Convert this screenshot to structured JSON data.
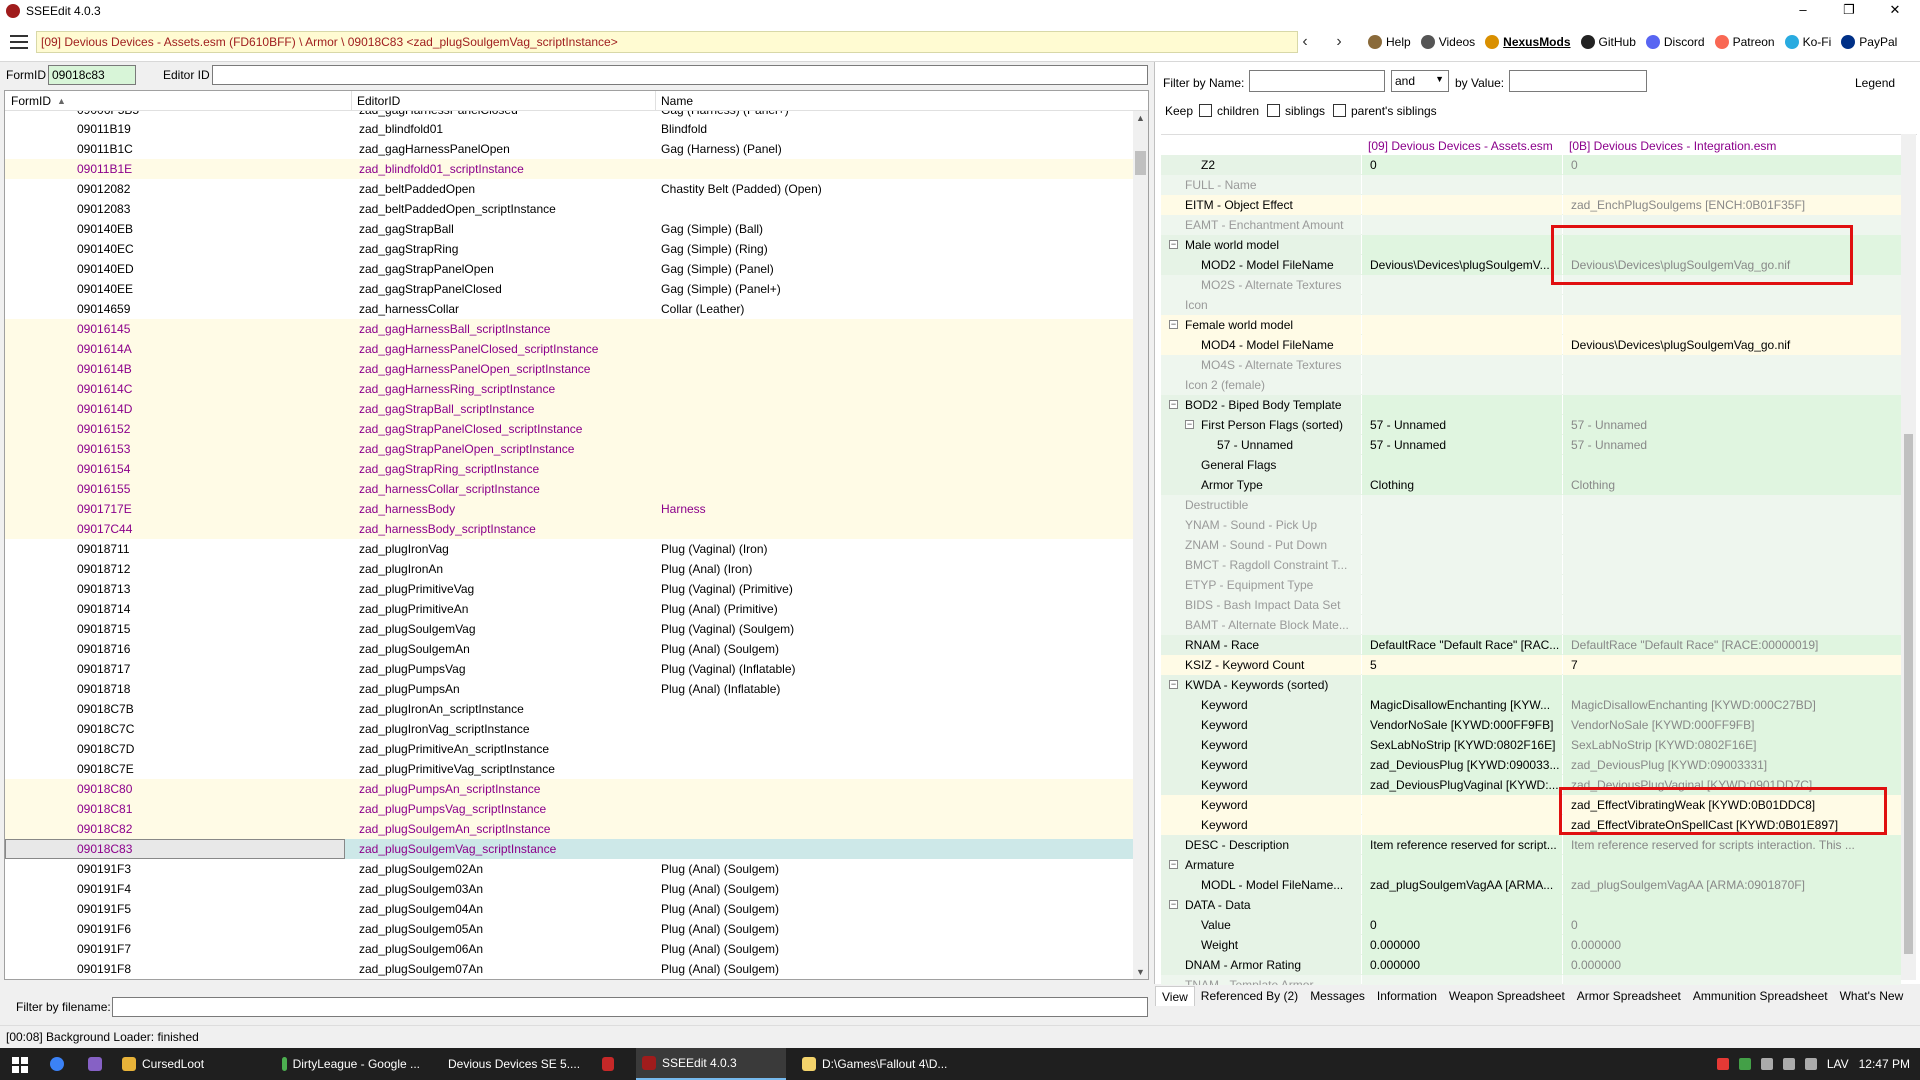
{
  "window": {
    "title": "SSEEdit 4.0.3",
    "minimize": "–",
    "maximize": "❐",
    "close": "✕"
  },
  "path": "[09] Devious Devices - Assets.esm (FD610BFF) \\ Armor \\ 09018C83 <zad_plugSoulgemVag_scriptInstance>",
  "nav": {
    "back": "‹",
    "forward": "›"
  },
  "links": [
    {
      "label": "Help",
      "color": "#8a6a3a",
      "bold": false
    },
    {
      "label": "Videos",
      "color": "#555555",
      "bold": false
    },
    {
      "label": "NexusMods",
      "color": "#d98f00",
      "bold": true
    },
    {
      "label": "GitHub",
      "color": "#222222",
      "bold": false
    },
    {
      "label": "Discord",
      "color": "#5865f2",
      "bold": false
    },
    {
      "label": "Patreon",
      "color": "#f96854",
      "bold": false
    },
    {
      "label": "Ko-Fi",
      "color": "#29abe0",
      "bold": false
    },
    {
      "label": "PayPal",
      "color": "#003087",
      "bold": false
    }
  ],
  "left": {
    "formid_label": "FormID",
    "formid_value": "09018c83",
    "editorid_label": "Editor ID",
    "headers": {
      "formid": "FormID",
      "sort": "▲",
      "editorid": "EditorID",
      "name": "Name"
    },
    "rows": [
      {
        "fid": "09011B19",
        "eid": "zad_blindfold01",
        "nm": "Blindfold",
        "y": false
      },
      {
        "fid": "09011B1C",
        "eid": "zad_gagHarnessPanelOpen",
        "nm": "Gag (Harness) (Panel)",
        "y": false
      },
      {
        "fid": "09011B1E",
        "eid": "zad_blindfold01_scriptInstance",
        "nm": "",
        "y": true
      },
      {
        "fid": "09012082",
        "eid": "zad_beltPaddedOpen",
        "nm": "Chastity Belt (Padded) (Open)",
        "y": false
      },
      {
        "fid": "09012083",
        "eid": "zad_beltPaddedOpen_scriptInstance",
        "nm": "",
        "y": false
      },
      {
        "fid": "090140EB",
        "eid": "zad_gagStrapBall",
        "nm": "Gag (Simple) (Ball)",
        "y": false
      },
      {
        "fid": "090140EC",
        "eid": "zad_gagStrapRing",
        "nm": "Gag (Simple) (Ring)",
        "y": false
      },
      {
        "fid": "090140ED",
        "eid": "zad_gagStrapPanelOpen",
        "nm": "Gag (Simple) (Panel)",
        "y": false
      },
      {
        "fid": "090140EE",
        "eid": "zad_gagStrapPanelClosed",
        "nm": "Gag (Simple) (Panel+)",
        "y": false
      },
      {
        "fid": "09014659",
        "eid": "zad_harnessCollar",
        "nm": "Collar (Leather)",
        "y": false
      },
      {
        "fid": "09016145",
        "eid": "zad_gagHarnessBall_scriptInstance",
        "nm": "",
        "y": true
      },
      {
        "fid": "0901614A",
        "eid": "zad_gagHarnessPanelClosed_scriptInstance",
        "nm": "",
        "y": true
      },
      {
        "fid": "0901614B",
        "eid": "zad_gagHarnessPanelOpen_scriptInstance",
        "nm": "",
        "y": true
      },
      {
        "fid": "0901614C",
        "eid": "zad_gagHarnessRing_scriptInstance",
        "nm": "",
        "y": true
      },
      {
        "fid": "0901614D",
        "eid": "zad_gagStrapBall_scriptInstance",
        "nm": "",
        "y": true
      },
      {
        "fid": "09016152",
        "eid": "zad_gagStrapPanelClosed_scriptInstance",
        "nm": "",
        "y": true
      },
      {
        "fid": "09016153",
        "eid": "zad_gagStrapPanelOpen_scriptInstance",
        "nm": "",
        "y": true
      },
      {
        "fid": "09016154",
        "eid": "zad_gagStrapRing_scriptInstance",
        "nm": "",
        "y": true
      },
      {
        "fid": "09016155",
        "eid": "zad_harnessCollar_scriptInstance",
        "nm": "",
        "y": true
      },
      {
        "fid": "0901717E",
        "eid": "zad_harnessBody",
        "nm": "Harness",
        "y": true
      },
      {
        "fid": "09017C44",
        "eid": "zad_harnessBody_scriptInstance",
        "nm": "",
        "y": true
      },
      {
        "fid": "09018711",
        "eid": "zad_plugIronVag",
        "nm": "Plug (Vaginal) (Iron)",
        "y": false
      },
      {
        "fid": "09018712",
        "eid": "zad_plugIronAn",
        "nm": "Plug (Anal) (Iron)",
        "y": false
      },
      {
        "fid": "09018713",
        "eid": "zad_plugPrimitiveVag",
        "nm": "Plug (Vaginal) (Primitive)",
        "y": false
      },
      {
        "fid": "09018714",
        "eid": "zad_plugPrimitiveAn",
        "nm": "Plug (Anal) (Primitive)",
        "y": false
      },
      {
        "fid": "09018715",
        "eid": "zad_plugSoulgemVag",
        "nm": "Plug (Vaginal) (Soulgem)",
        "y": false
      },
      {
        "fid": "09018716",
        "eid": "zad_plugSoulgemAn",
        "nm": "Plug (Anal) (Soulgem)",
        "y": false
      },
      {
        "fid": "09018717",
        "eid": "zad_plugPumpsVag",
        "nm": "Plug (Vaginal) (Inflatable)",
        "y": false
      },
      {
        "fid": "09018718",
        "eid": "zad_plugPumpsAn",
        "nm": "Plug (Anal) (Inflatable)",
        "y": false
      },
      {
        "fid": "09018C7B",
        "eid": "zad_plugIronAn_scriptInstance",
        "nm": "",
        "y": false
      },
      {
        "fid": "09018C7C",
        "eid": "zad_plugIronVag_scriptInstance",
        "nm": "",
        "y": false
      },
      {
        "fid": "09018C7D",
        "eid": "zad_plugPrimitiveAn_scriptInstance",
        "nm": "",
        "y": false
      },
      {
        "fid": "09018C7E",
        "eid": "zad_plugPrimitiveVag_scriptInstance",
        "nm": "",
        "y": false
      },
      {
        "fid": "09018C80",
        "eid": "zad_plugPumpsAn_scriptInstance",
        "nm": "",
        "y": true
      },
      {
        "fid": "09018C81",
        "eid": "zad_plugPumpsVag_scriptInstance",
        "nm": "",
        "y": true
      },
      {
        "fid": "09018C82",
        "eid": "zad_plugSoulgemAn_scriptInstance",
        "nm": "",
        "y": true
      },
      {
        "fid": "09018C83",
        "eid": "zad_plugSoulgemVag_scriptInstance",
        "nm": "",
        "y": true,
        "sel": true
      },
      {
        "fid": "090191F3",
        "eid": "zad_plugSoulgem02An",
        "nm": "Plug (Anal) (Soulgem)",
        "y": false
      },
      {
        "fid": "090191F4",
        "eid": "zad_plugSoulgem03An",
        "nm": "Plug (Anal) (Soulgem)",
        "y": false
      },
      {
        "fid": "090191F5",
        "eid": "zad_plugSoulgem04An",
        "nm": "Plug (Anal) (Soulgem)",
        "y": false
      },
      {
        "fid": "090191F6",
        "eid": "zad_plugSoulgem05An",
        "nm": "Plug (Anal) (Soulgem)",
        "y": false
      },
      {
        "fid": "090191F7",
        "eid": "zad_plugSoulgem06An",
        "nm": "Plug (Anal) (Soulgem)",
        "y": false
      },
      {
        "fid": "090191F8",
        "eid": "zad_plugSoulgem07An",
        "nm": "Plug (Anal) (Soulgem)",
        "y": false
      }
    ],
    "top_partial": {
      "fid": "09006F5B5",
      "eid": "zad_gagHarnessPanelClosed",
      "nm": "Gag (Harness) (Panel+)"
    },
    "filter_label": "Filter by filename:"
  },
  "right": {
    "filter_name_label": "Filter by Name:",
    "and_value": "and",
    "by_value_label": "by Value:",
    "legend": "Legend",
    "keep_label": "Keep",
    "children": "children",
    "siblings": "siblings",
    "parents_siblings": "parent's siblings",
    "col1": "[09] Devious Devices - Assets.esm",
    "col2": "[0B] Devious Devices - Integration.esm",
    "rows": [
      {
        "lab": "Z2",
        "ind": 2,
        "v1": "0",
        "v2": "0",
        "dim": false
      },
      {
        "lab": "FULL - Name",
        "ind": 1,
        "v1": "",
        "v2": "",
        "dim": true
      },
      {
        "lab": "EITM - Object Effect",
        "ind": 1,
        "v1": "",
        "v2": "zad_EnchPlugSoulgems [ENCH:0B01F35F]",
        "dim": false,
        "hl": true
      },
      {
        "lab": "EAMT - Enchantment Amount",
        "ind": 1,
        "v1": "",
        "v2": "",
        "dim": true
      },
      {
        "lab": "Male world model",
        "ind": 1,
        "v1": "",
        "v2": "",
        "dim": false,
        "exp": true
      },
      {
        "lab": "MOD2 - Model FileName",
        "ind": 2,
        "v1": "Devious\\Devices\\plugSoulgemV...",
        "v2": "Devious\\Devices\\plugSoulgemVag_go.nif",
        "dim": false
      },
      {
        "lab": "MO2S - Alternate Textures",
        "ind": 2,
        "v1": "",
        "v2": "",
        "dim": true
      },
      {
        "lab": "Icon",
        "ind": 1,
        "v1": "",
        "v2": "",
        "dim": true
      },
      {
        "lab": "Female world model",
        "ind": 1,
        "v1": "",
        "v2": "",
        "dim": false,
        "exp": true,
        "hl": true
      },
      {
        "lab": "MOD4 - Model FileName",
        "ind": 2,
        "v1": "",
        "v2": "Devious\\Devices\\plugSoulgemVag_go.nif",
        "dim": false,
        "hl": true,
        "v2dark": true
      },
      {
        "lab": "MO4S - Alternate Textures",
        "ind": 2,
        "v1": "",
        "v2": "",
        "dim": true
      },
      {
        "lab": "Icon 2 (female)",
        "ind": 1,
        "v1": "",
        "v2": "",
        "dim": true
      },
      {
        "lab": "BOD2 - Biped Body Template",
        "ind": 1,
        "v1": "",
        "v2": "",
        "dim": false,
        "exp": true
      },
      {
        "lab": "First Person Flags (sorted)",
        "ind": 2,
        "v1": "57 - Unnamed",
        "v2": "57 - Unnamed",
        "dim": false,
        "exp": true
      },
      {
        "lab": "57 - Unnamed",
        "ind": 3,
        "v1": "57 - Unnamed",
        "v2": "57 - Unnamed",
        "dim": false
      },
      {
        "lab": "General Flags",
        "ind": 2,
        "v1": "",
        "v2": "",
        "dim": false
      },
      {
        "lab": "Armor Type",
        "ind": 2,
        "v1": "Clothing",
        "v2": "Clothing",
        "dim": false
      },
      {
        "lab": "Destructible",
        "ind": 1,
        "v1": "",
        "v2": "",
        "dim": true
      },
      {
        "lab": "YNAM - Sound - Pick Up",
        "ind": 1,
        "v1": "",
        "v2": "",
        "dim": true
      },
      {
        "lab": "ZNAM - Sound - Put Down",
        "ind": 1,
        "v1": "",
        "v2": "",
        "dim": true
      },
      {
        "lab": "BMCT - Ragdoll Constraint T...",
        "ind": 1,
        "v1": "",
        "v2": "",
        "dim": true
      },
      {
        "lab": "ETYP - Equipment Type",
        "ind": 1,
        "v1": "",
        "v2": "",
        "dim": true
      },
      {
        "lab": "BIDS - Bash Impact Data Set",
        "ind": 1,
        "v1": "",
        "v2": "",
        "dim": true
      },
      {
        "lab": "BAMT - Alternate Block Mate...",
        "ind": 1,
        "v1": "",
        "v2": "",
        "dim": true
      },
      {
        "lab": "RNAM - Race",
        "ind": 1,
        "v1": "DefaultRace \"Default Race\" [RAC...",
        "v2": "DefaultRace \"Default Race\" [RACE:00000019]",
        "dim": false
      },
      {
        "lab": "KSIZ - Keyword Count",
        "ind": 1,
        "v1": "5",
        "v2": "7",
        "dim": false,
        "hl": true,
        "v2dark": true
      },
      {
        "lab": "KWDA - Keywords (sorted)",
        "ind": 1,
        "v1": "",
        "v2": "",
        "dim": false,
        "exp": true
      },
      {
        "lab": "Keyword",
        "ind": 2,
        "v1": "MagicDisallowEnchanting [KYW...",
        "v2": "MagicDisallowEnchanting [KYWD:000C27BD]",
        "dim": false
      },
      {
        "lab": "Keyword",
        "ind": 2,
        "v1": "VendorNoSale [KYWD:000FF9FB]",
        "v2": "VendorNoSale [KYWD:000FF9FB]",
        "dim": false
      },
      {
        "lab": "Keyword",
        "ind": 2,
        "v1": "SexLabNoStrip [KYWD:0802F16E]",
        "v2": "SexLabNoStrip [KYWD:0802F16E]",
        "dim": false
      },
      {
        "lab": "Keyword",
        "ind": 2,
        "v1": "zad_DeviousPlug [KYWD:090033...",
        "v2": "zad_DeviousPlug [KYWD:09003331]",
        "dim": false
      },
      {
        "lab": "Keyword",
        "ind": 2,
        "v1": "zad_DeviousPlugVaginal [KYWD:...",
        "v2": "zad_DeviousPlugVaginal [KYWD:0901DD7C]",
        "dim": false
      },
      {
        "lab": "Keyword",
        "ind": 2,
        "v1": "",
        "v2": "zad_EffectVibratingWeak [KYWD:0B01DDC8]",
        "dim": false,
        "hl": true,
        "v2dark": true
      },
      {
        "lab": "Keyword",
        "ind": 2,
        "v1": "",
        "v2": "zad_EffectVibrateOnSpellCast [KYWD:0B01E897]",
        "dim": false,
        "hl": true,
        "v2dark": true
      },
      {
        "lab": "DESC - Description",
        "ind": 1,
        "v1": "Item reference reserved for script...",
        "v2": "Item reference reserved for scripts interaction. This ...",
        "dim": false
      },
      {
        "lab": "Armature",
        "ind": 1,
        "v1": "",
        "v2": "",
        "dim": false,
        "exp": true
      },
      {
        "lab": "MODL - Model FileName...",
        "ind": 2,
        "v1": "zad_plugSoulgemVagAA [ARMA...",
        "v2": "zad_plugSoulgemVagAA [ARMA:0901870F]",
        "dim": false
      },
      {
        "lab": "DATA - Data",
        "ind": 1,
        "v1": "",
        "v2": "",
        "dim": false,
        "exp": true
      },
      {
        "lab": "Value",
        "ind": 2,
        "v1": "0",
        "v2": "0",
        "dim": false
      },
      {
        "lab": "Weight",
        "ind": 2,
        "v1": "0.000000",
        "v2": "0.000000",
        "dim": false
      },
      {
        "lab": "DNAM - Armor Rating",
        "ind": 1,
        "v1": "0.000000",
        "v2": "0.000000",
        "dim": false
      },
      {
        "lab": "TNAM - Template Armor",
        "ind": 1,
        "v1": "",
        "v2": "",
        "dim": true
      }
    ],
    "tabs": [
      "View",
      "Referenced By (2)",
      "Messages",
      "Information",
      "Weapon Spreadsheet",
      "Armor Spreadsheet",
      "Ammunition Spreadsheet",
      "What's New"
    ]
  },
  "status": "[00:08] Background Loader: finished",
  "taskbar": {
    "items": [
      {
        "label": "CursedLoot",
        "color": "#e8b339"
      },
      {
        "label": "DirtyLeague - Google ...",
        "color": "#4caf50"
      },
      {
        "label": "Devious Devices SE 5....",
        "color": "#e0533d"
      },
      {
        "label": "",
        "color": "#c62828"
      },
      {
        "label": "SSEEdit 4.0.3",
        "color": "#a01c1c",
        "active": true
      },
      {
        "label": "D:\\Games\\Fallout 4\\D...",
        "color": "#f3d36b"
      }
    ],
    "lang": "LAV",
    "time": "12:47 PM"
  }
}
